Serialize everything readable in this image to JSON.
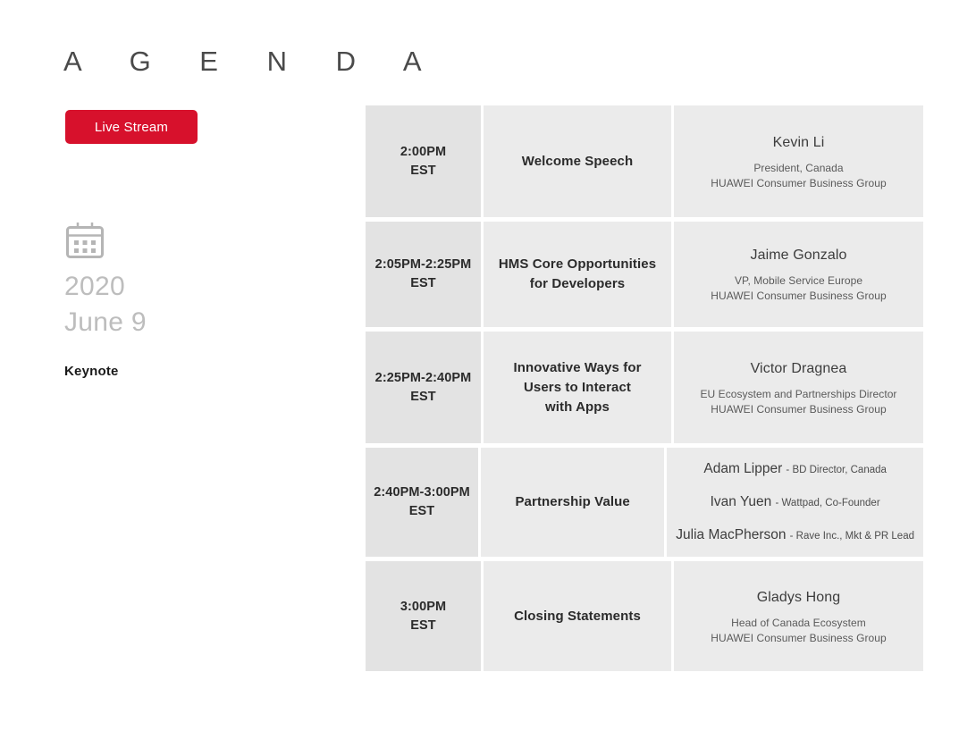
{
  "page": {
    "title": "A G E N D A"
  },
  "live_stream": {
    "label": "Live Stream",
    "color": "#D7112C"
  },
  "date_block": {
    "icon": "calendar-icon",
    "year": "2020",
    "day": "June 9",
    "session_label": "Keynote"
  },
  "agenda": {
    "rows": [
      {
        "time": "2:00PM\nEST",
        "time_line1": "2:00PM",
        "time_line2": "EST",
        "topic_line1": "Welcome Speech",
        "topic_line2": "",
        "topic_line3": "",
        "speaker_name": "Kevin Li",
        "speaker_title": "President, Canada",
        "speaker_org": "HUAWEI Consumer Business Group"
      },
      {
        "time_line1": "2:05PM-2:25PM",
        "time_line2": "EST",
        "topic_line1": "HMS Core Opportunities",
        "topic_line2": "for Developers",
        "topic_line3": "",
        "speaker_name": "Jaime Gonzalo",
        "speaker_title": "VP, Mobile Service Europe",
        "speaker_org": "HUAWEI Consumer Business Group"
      },
      {
        "time_line1": "2:25PM-2:40PM",
        "time_line2": "EST",
        "topic_line1": "Innovative Ways for",
        "topic_line2": "Users to Interact",
        "topic_line3": "with Apps",
        "speaker_name": "Victor Dragnea",
        "speaker_title": "EU Ecosystem and Partnerships Director",
        "speaker_org": "HUAWEI Consumer Business Group"
      },
      {
        "time_line1": "2:40PM-3:00PM",
        "time_line2": "EST",
        "topic_line1": "Partnership Value",
        "topic_line2": "",
        "topic_line3": "",
        "panel": [
          {
            "name": "Adam Lipper",
            "role": "- BD Director, Canada"
          },
          {
            "name": "Ivan Yuen",
            "role": "- Wattpad, Co-Founder"
          },
          {
            "name": "Julia MacPherson",
            "role": "- Rave Inc., Mkt & PR Lead"
          }
        ]
      },
      {
        "time_line1": "3:00PM",
        "time_line2": "EST",
        "topic_line1": "Closing Statements",
        "topic_line2": "",
        "topic_line3": "",
        "speaker_name": "Gladys Hong",
        "speaker_title": "Head of Canada Ecosystem",
        "speaker_org": "HUAWEI Consumer Business Group"
      }
    ]
  }
}
